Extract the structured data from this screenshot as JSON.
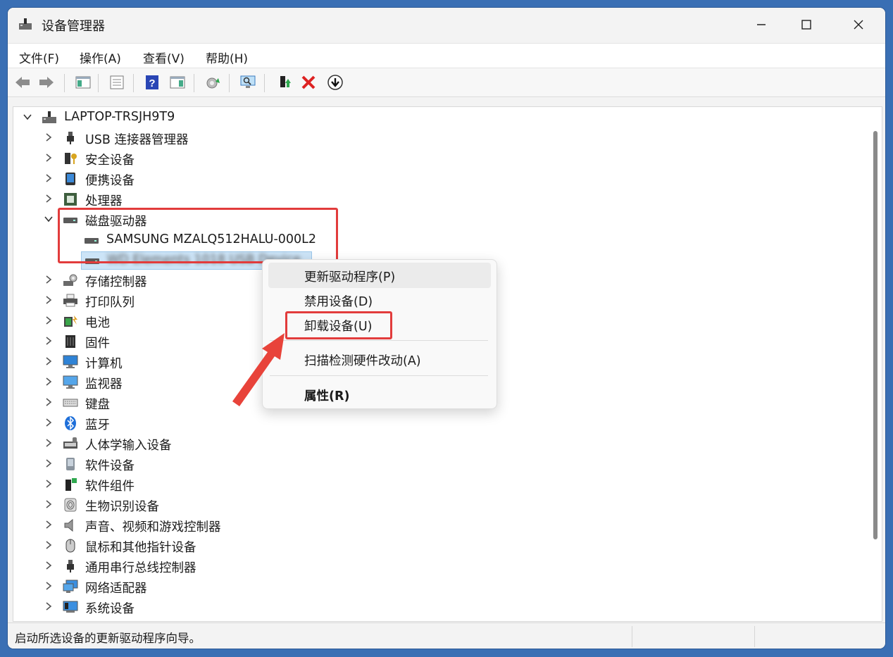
{
  "window": {
    "title": "设备管理器"
  },
  "menu": [
    "文件(F)",
    "操作(A)",
    "查看(V)",
    "帮助(H)"
  ],
  "toolbar": {
    "icons": [
      "back-arrow-icon",
      "forward-arrow-icon",
      "show-hide-tree-icon",
      "properties-icon",
      "help-icon",
      "view-icon",
      "update-driver-icon",
      "scan-hardware-icon",
      "enable-device-icon",
      "uninstall-x-icon",
      "download-arrow-icon"
    ]
  },
  "tree": {
    "root": "LAPTOP-TRSJH9T9",
    "categories": [
      "USB 连接器管理器",
      "安全设备",
      "便携设备",
      "处理器",
      "磁盘驱动器",
      "存储控制器",
      "打印队列",
      "电池",
      "固件",
      "计算机",
      "监视器",
      "键盘",
      "蓝牙",
      "人体学输入设备",
      "软件设备",
      "软件组件",
      "生物识别设备",
      "声音、视频和游戏控制器",
      "鼠标和其他指针设备",
      "通用串行总线控制器",
      "网络适配器",
      "系统设备"
    ],
    "disk_children": [
      "SAMSUNG MZALQ512HALU-000L2",
      "WD Elements 1018 USB Device"
    ]
  },
  "context_menu": {
    "items": [
      "更新驱动程序(P)",
      "禁用设备(D)",
      "卸载设备(U)",
      "扫描检测硬件改动(A)",
      "属性(R)"
    ]
  },
  "status": {
    "text": "启动所选设备的更新驱动程序向导。"
  },
  "colors": {
    "highlight_red": "#e23c3c",
    "selection": "#cce4f7",
    "accent_blue": "#3a6fb4"
  }
}
